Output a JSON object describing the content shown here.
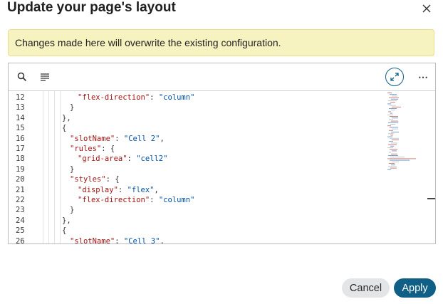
{
  "dialog": {
    "title": "Update your page's layout",
    "warning": "Changes made here will overwrite the existing configuration."
  },
  "toolbar": {
    "icons": [
      "search-icon",
      "format-lines-icon",
      "expand-icon",
      "more-icon"
    ],
    "more_label": "⋯"
  },
  "editor": {
    "lines": [
      {
        "num": "12",
        "depth": 4,
        "parts": [
          [
            "k",
            "\"flex-direction\""
          ],
          [
            "p",
            ": "
          ],
          [
            "s",
            "\"column\""
          ]
        ]
      },
      {
        "num": "13",
        "depth": 3,
        "parts": [
          [
            "p",
            "}"
          ]
        ]
      },
      {
        "num": "14",
        "depth": 2,
        "parts": [
          [
            "p",
            "},"
          ]
        ]
      },
      {
        "num": "15",
        "depth": 2,
        "parts": [
          [
            "p",
            "{"
          ]
        ]
      },
      {
        "num": "16",
        "depth": 3,
        "parts": [
          [
            "k",
            "\"slotName\""
          ],
          [
            "p",
            ": "
          ],
          [
            "s",
            "\"Cell 2\""
          ],
          [
            "p",
            ","
          ]
        ]
      },
      {
        "num": "17",
        "depth": 3,
        "parts": [
          [
            "k",
            "\"rules\""
          ],
          [
            "p",
            ": {"
          ]
        ]
      },
      {
        "num": "18",
        "depth": 4,
        "parts": [
          [
            "k",
            "\"grid-area\""
          ],
          [
            "p",
            ": "
          ],
          [
            "s",
            "\"cell2\""
          ]
        ]
      },
      {
        "num": "19",
        "depth": 3,
        "parts": [
          [
            "p",
            "}"
          ]
        ]
      },
      {
        "num": "20",
        "depth": 3,
        "parts": [
          [
            "k",
            "\"styles\""
          ],
          [
            "p",
            ": {"
          ]
        ]
      },
      {
        "num": "21",
        "depth": 4,
        "parts": [
          [
            "k",
            "\"display\""
          ],
          [
            "p",
            ": "
          ],
          [
            "s",
            "\"flex\""
          ],
          [
            "p",
            ","
          ]
        ]
      },
      {
        "num": "22",
        "depth": 4,
        "parts": [
          [
            "k",
            "\"flex-direction\""
          ],
          [
            "p",
            ": "
          ],
          [
            "s",
            "\"column\""
          ]
        ]
      },
      {
        "num": "23",
        "depth": 3,
        "parts": [
          [
            "p",
            "}"
          ]
        ]
      },
      {
        "num": "24",
        "depth": 2,
        "parts": [
          [
            "p",
            "},"
          ]
        ]
      },
      {
        "num": "25",
        "depth": 2,
        "parts": [
          [
            "p",
            "{"
          ]
        ]
      },
      {
        "num": "26",
        "depth": 3,
        "parts": [
          [
            "k",
            "\"slotName\""
          ],
          [
            "p",
            ": "
          ],
          [
            "s",
            "\"Cell 3\""
          ],
          [
            "p",
            ","
          ]
        ]
      }
    ]
  },
  "footer": {
    "cancel_label": "Cancel",
    "apply_label": "Apply"
  },
  "colors": {
    "key": "#a31515",
    "string": "#0451a5",
    "accent": "#0f5f86",
    "warning_bg": "#f7f3c1"
  }
}
